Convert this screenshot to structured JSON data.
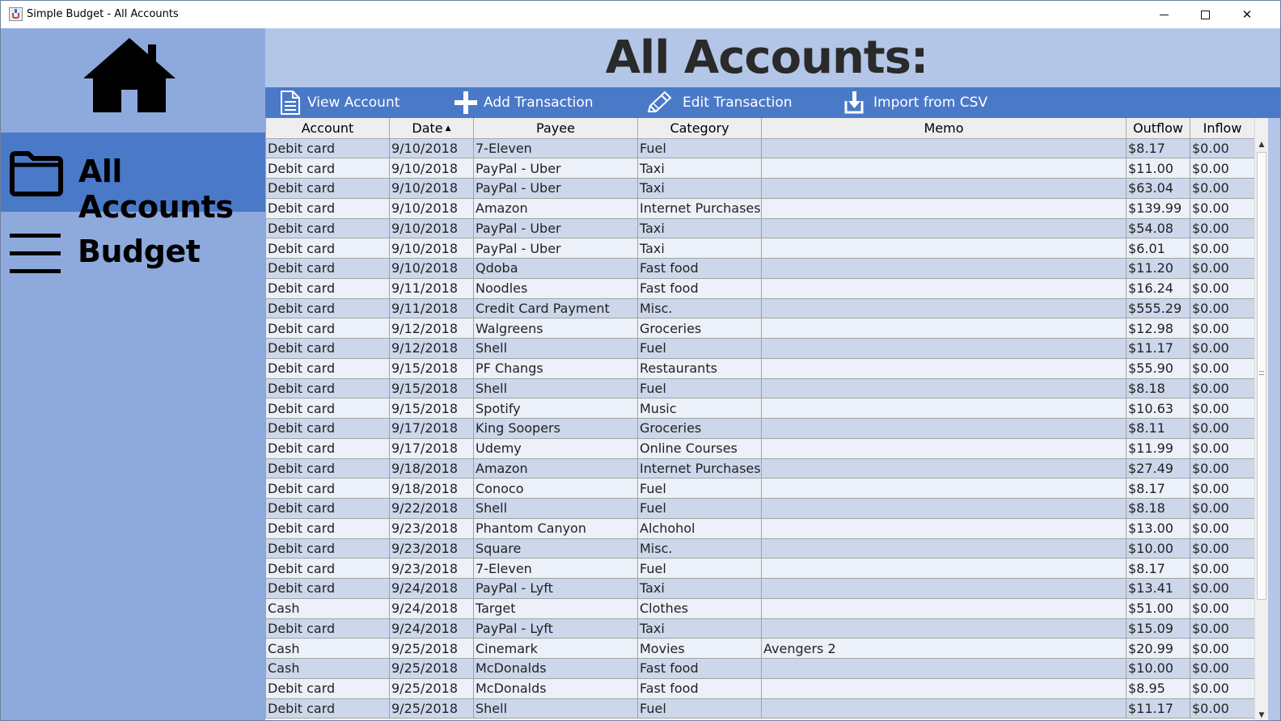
{
  "window": {
    "title": "Simple Budget - All Accounts",
    "controls": {
      "minimize": "",
      "maximize": "",
      "close": "✕"
    }
  },
  "sidebar": {
    "items": [
      {
        "label": "All Accounts",
        "icon": "folder-icon",
        "active": true
      },
      {
        "label": "Budget",
        "icon": "menu-icon",
        "active": false
      }
    ],
    "accent": "#4a79c8",
    "background": "#8eaadc"
  },
  "header": {
    "title": "All Accounts:"
  },
  "toolbar": {
    "view_account": "View Account",
    "add_transaction": "Add Transaction",
    "edit_transaction": "Edit Transaction",
    "import_csv": "Import from CSV"
  },
  "table": {
    "columns": [
      "Account",
      "Date",
      "Payee",
      "Category",
      "Memo",
      "Outflow",
      "Inflow"
    ],
    "sorted_column": "Date",
    "rows": [
      [
        "Debit card",
        "9/10/2018",
        "7-Eleven",
        "Fuel",
        "",
        "$8.17",
        "$0.00"
      ],
      [
        "Debit card",
        "9/10/2018",
        "PayPal - Uber",
        "Taxi",
        "",
        "$11.00",
        "$0.00"
      ],
      [
        "Debit card",
        "9/10/2018",
        "PayPal - Uber",
        "Taxi",
        "",
        "$63.04",
        "$0.00"
      ],
      [
        "Debit card",
        "9/10/2018",
        "Amazon",
        "Internet Purchases",
        "",
        "$139.99",
        "$0.00"
      ],
      [
        "Debit card",
        "9/10/2018",
        "PayPal - Uber",
        "Taxi",
        "",
        "$54.08",
        "$0.00"
      ],
      [
        "Debit card",
        "9/10/2018",
        "PayPal - Uber",
        "Taxi",
        "",
        "$6.01",
        "$0.00"
      ],
      [
        "Debit card",
        "9/10/2018",
        "Qdoba",
        "Fast food",
        "",
        "$11.20",
        "$0.00"
      ],
      [
        "Debit card",
        "9/11/2018",
        "Noodles",
        "Fast food",
        "",
        "$16.24",
        "$0.00"
      ],
      [
        "Debit card",
        "9/11/2018",
        "Credit Card Payment",
        "Misc.",
        "",
        "$555.29",
        "$0.00"
      ],
      [
        "Debit card",
        "9/12/2018",
        "Walgreens",
        "Groceries",
        "",
        "$12.98",
        "$0.00"
      ],
      [
        "Debit card",
        "9/12/2018",
        "Shell",
        "Fuel",
        "",
        "$11.17",
        "$0.00"
      ],
      [
        "Debit card",
        "9/15/2018",
        "PF Changs",
        "Restaurants",
        "",
        "$55.90",
        "$0.00"
      ],
      [
        "Debit card",
        "9/15/2018",
        "Shell",
        "Fuel",
        "",
        "$8.18",
        "$0.00"
      ],
      [
        "Debit card",
        "9/15/2018",
        "Spotify",
        "Music",
        "",
        "$10.63",
        "$0.00"
      ],
      [
        "Debit card",
        "9/17/2018",
        "King Soopers",
        "Groceries",
        "",
        "$8.11",
        "$0.00"
      ],
      [
        "Debit card",
        "9/17/2018",
        "Udemy",
        "Online Courses",
        "",
        "$11.99",
        "$0.00"
      ],
      [
        "Debit card",
        "9/18/2018",
        "Amazon",
        "Internet Purchases",
        "",
        "$27.49",
        "$0.00"
      ],
      [
        "Debit card",
        "9/18/2018",
        "Conoco",
        "Fuel",
        "",
        "$8.17",
        "$0.00"
      ],
      [
        "Debit card",
        "9/22/2018",
        "Shell",
        "Fuel",
        "",
        "$8.18",
        "$0.00"
      ],
      [
        "Debit card",
        "9/23/2018",
        "Phantom Canyon",
        "Alchohol",
        "",
        "$13.00",
        "$0.00"
      ],
      [
        "Debit card",
        "9/23/2018",
        "Square",
        "Misc.",
        "",
        "$10.00",
        "$0.00"
      ],
      [
        "Debit card",
        "9/23/2018",
        "7-Eleven",
        "Fuel",
        "",
        "$8.17",
        "$0.00"
      ],
      [
        "Debit card",
        "9/24/2018",
        "PayPal - Lyft",
        "Taxi",
        "",
        "$13.41",
        "$0.00"
      ],
      [
        "Cash",
        "9/24/2018",
        "Target",
        "Clothes",
        "",
        "$51.00",
        "$0.00"
      ],
      [
        "Debit card",
        "9/24/2018",
        "PayPal - Lyft",
        "Taxi",
        "",
        "$15.09",
        "$0.00"
      ],
      [
        "Cash",
        "9/25/2018",
        "Cinemark",
        "Movies",
        "Avengers 2",
        "$20.99",
        "$0.00"
      ],
      [
        "Cash",
        "9/25/2018",
        "McDonalds",
        "Fast food",
        "",
        "$10.00",
        "$0.00"
      ],
      [
        "Debit card",
        "9/25/2018",
        "McDonalds",
        "Fast food",
        "",
        "$8.95",
        "$0.00"
      ],
      [
        "Debit card",
        "9/25/2018",
        "Shell",
        "Fuel",
        "",
        "$11.17",
        "$0.00"
      ]
    ]
  }
}
